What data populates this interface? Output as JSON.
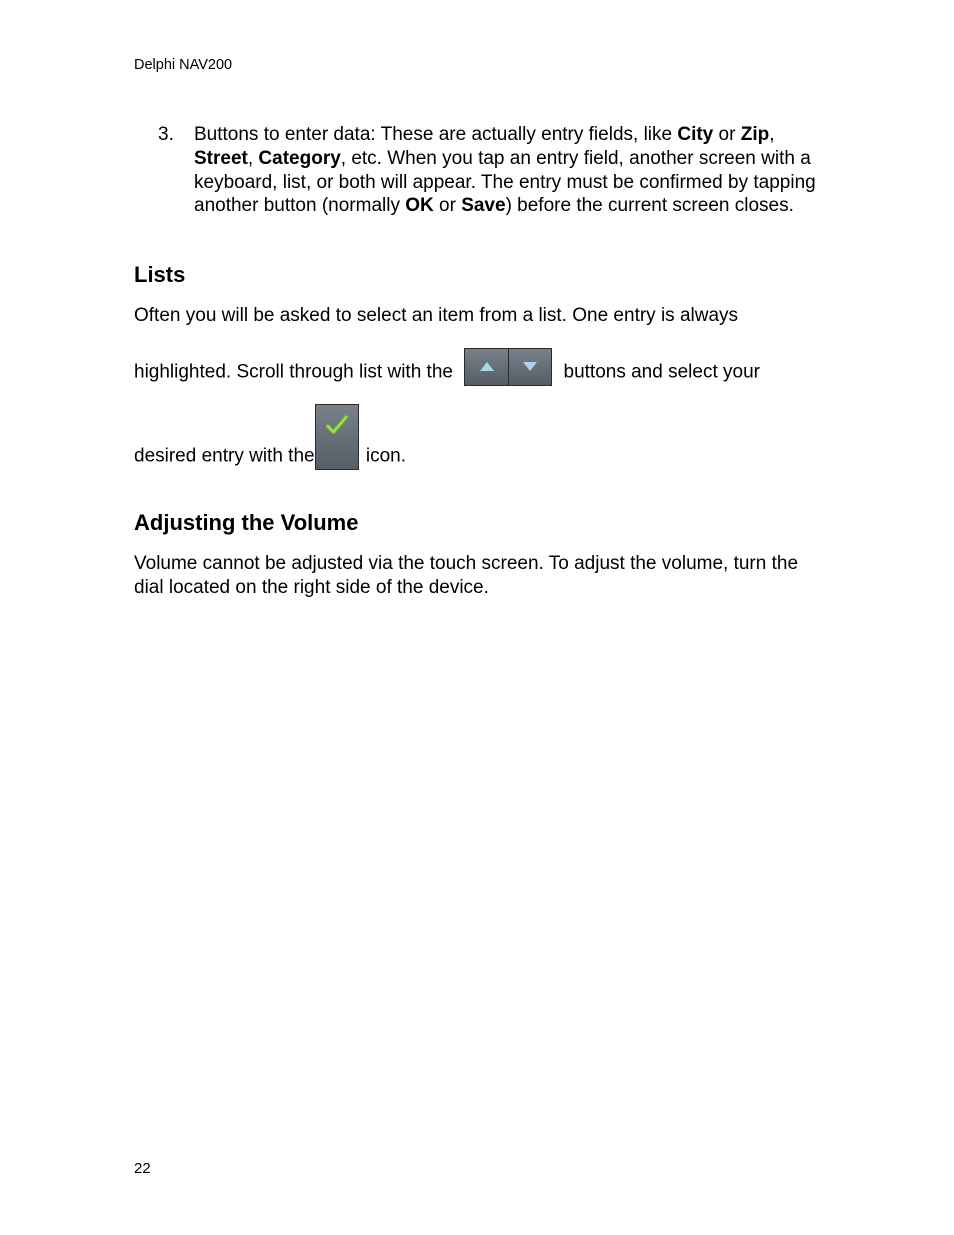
{
  "header": "Delphi NAV200",
  "list_item_3": {
    "number": "3.",
    "t1": "Buttons to enter data: These are actually entry fields, like ",
    "b1": "City",
    "t2": " or ",
    "b2": "Zip",
    "t3": ", ",
    "b3": "Street",
    "t4": ", ",
    "b4": "Category",
    "t5": ", etc. When you tap an entry field, another screen with a keyboard, list, or both will appear. The entry must be confirmed by tapping another button (normally ",
    "b5": "OK",
    "t6": " or ",
    "b6": "Save",
    "t7": ") before the current screen closes."
  },
  "lists": {
    "heading": "Lists",
    "p1": "Often you will be asked to select an item from a list. One entry is always",
    "p2a": "highlighted. Scroll through list with the ",
    "p2b": " buttons and select your",
    "p3a": "desired entry with the",
    "p3b": " icon."
  },
  "volume": {
    "heading": "Adjusting the Volume",
    "p1": "Volume cannot be adjusted via the touch screen. To adjust the volume, turn the dial located on the right side of the device."
  },
  "page_number": "22"
}
